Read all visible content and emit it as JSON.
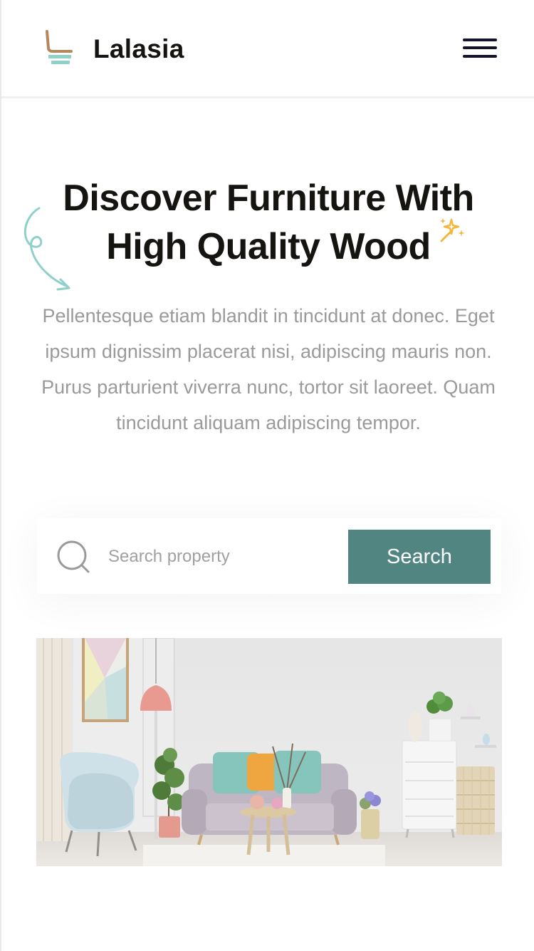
{
  "header": {
    "brand": "Lalasia",
    "logo_icon": "chair-logo-icon",
    "menu_icon": "hamburger-menu-icon"
  },
  "hero": {
    "title_line1": "Discover Furniture With",
    "title_line2": "High Quality Wood",
    "description": "Pellentesque etiam blandit in tincidunt at donec. Eget ipsum dignissim placerat nisi, adipiscing mauris non. Purus parturient viverra nunc, tortor sit laoreet. Quam tincidunt aliquam adipiscing tempor."
  },
  "search": {
    "placeholder": "Search property",
    "value": "",
    "button_label": "Search",
    "icon": "search-icon"
  },
  "colors": {
    "accent": "#518581",
    "title": "#151411",
    "body_text": "#9a9a9a",
    "logo_top": "#b7865c",
    "logo_bottom": "#8fd0c8",
    "spark": "#f3b63d"
  }
}
